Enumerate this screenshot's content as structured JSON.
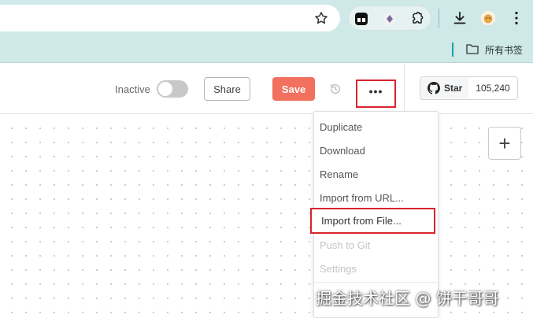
{
  "browser": {
    "bookmarks_label": "所有书签",
    "accent_color": "#cfe8e8"
  },
  "header": {
    "status_label": "Inactive",
    "share_label": "Share",
    "save_label": "Save",
    "more_label": "•••",
    "github_star_label": "Star",
    "github_star_count": "105,240",
    "save_color": "#f2705e"
  },
  "menu": {
    "items": [
      {
        "label": "Duplicate",
        "disabled": false
      },
      {
        "label": "Download",
        "disabled": false
      },
      {
        "label": "Rename",
        "disabled": false
      },
      {
        "label": "Import from URL...",
        "disabled": false
      },
      {
        "label": "Import from File...",
        "disabled": false,
        "highlighted": true
      },
      {
        "label": "Push to Git",
        "disabled": true
      },
      {
        "label": "Settings",
        "disabled": true
      }
    ]
  },
  "canvas": {
    "zoom_add_label": "+"
  },
  "watermark": {
    "text": "掘金技术社区 @ 饼干哥哥"
  }
}
